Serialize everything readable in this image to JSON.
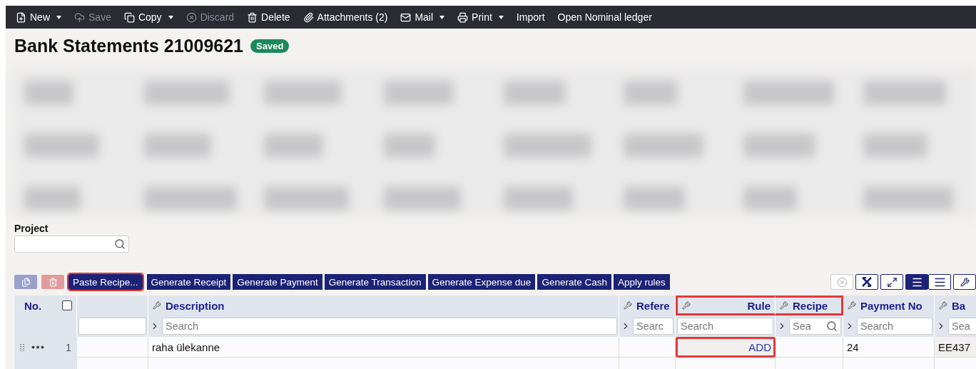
{
  "toolbar": [
    {
      "label": "New",
      "disabled": false,
      "dropdown": true
    },
    {
      "label": "Save",
      "disabled": true,
      "dropdown": false
    },
    {
      "label": "Copy",
      "disabled": false,
      "dropdown": true
    },
    {
      "label": "Discard",
      "disabled": true,
      "dropdown": false
    },
    {
      "label": "Delete",
      "disabled": false,
      "dropdown": false
    },
    {
      "label": "Attachments (2)",
      "disabled": false,
      "dropdown": false
    },
    {
      "label": "Mail",
      "disabled": false,
      "dropdown": true
    },
    {
      "label": "Print",
      "disabled": false,
      "dropdown": true
    },
    {
      "label": "Import",
      "disabled": false,
      "dropdown": false
    },
    {
      "label": "Open Nominal ledger",
      "disabled": false,
      "dropdown": false
    }
  ],
  "title": "Bank Statements 21009621",
  "status_badge": "Saved",
  "project": {
    "label": "Project"
  },
  "actions": [
    {
      "label": "Paste Recipe...",
      "highlighted": true
    },
    {
      "label": "Generate Receipt",
      "highlighted": false
    },
    {
      "label": "Generate Payment",
      "highlighted": false
    },
    {
      "label": "Generate Transaction",
      "highlighted": false
    },
    {
      "label": "Generate Expense due",
      "highlighted": false
    },
    {
      "label": "Generate Cash",
      "highlighted": false
    },
    {
      "label": "Apply rules",
      "highlighted": false
    }
  ],
  "view_toggles": [
    {
      "kind": "list",
      "selected": true
    },
    {
      "kind": "dense",
      "selected": false
    }
  ],
  "table": {
    "columns": [
      {
        "label": "No.",
        "kind": "number",
        "checked": false
      },
      {
        "kind": "blank",
        "highlighted": false,
        "filter": {
          "chevron": false,
          "lookup": false
        }
      },
      {
        "label": "Description",
        "kind": "text",
        "highlighted": false,
        "filter": {
          "placeholder": "Search",
          "chevron": true,
          "lookup": false
        }
      },
      {
        "label": "Refere",
        "kind": "text",
        "highlighted": false,
        "filter": {
          "placeholder": "Searc",
          "chevron": true,
          "lookup": false
        }
      },
      {
        "label": "Rule",
        "kind": "link",
        "highlighted": true,
        "filter": {
          "placeholder": "Search",
          "chevron": false,
          "lookup": false
        }
      },
      {
        "label": "Recipe",
        "kind": "text",
        "highlighted": true,
        "filter": {
          "placeholder": "Sea",
          "chevron": true,
          "lookup": true
        }
      },
      {
        "label": "Payment No",
        "kind": "text",
        "highlighted": false,
        "filter": {
          "placeholder": "Search",
          "chevron": true,
          "lookup": false
        }
      },
      {
        "label": "Ba",
        "kind": "text",
        "highlighted": false,
        "filter": {
          "placeholder": "Sea",
          "chevron": true,
          "lookup": false
        }
      }
    ],
    "rows": [
      {
        "cells": [
          {
            "text": "1"
          },
          {
            "shaded": false,
            "highlighted": false
          },
          {
            "text": "raha ülekanne",
            "shaded": false,
            "highlighted": false
          },
          {
            "shaded": false,
            "highlighted": false
          },
          {
            "text": "ADD",
            "shaded": true,
            "highlighted": true
          },
          {
            "shaded": false,
            "highlighted": false
          },
          {
            "text": "24",
            "shaded": false,
            "highlighted": false
          },
          {
            "text": "EE437",
            "shaded": true,
            "highlighted": false
          }
        ]
      }
    ]
  }
}
